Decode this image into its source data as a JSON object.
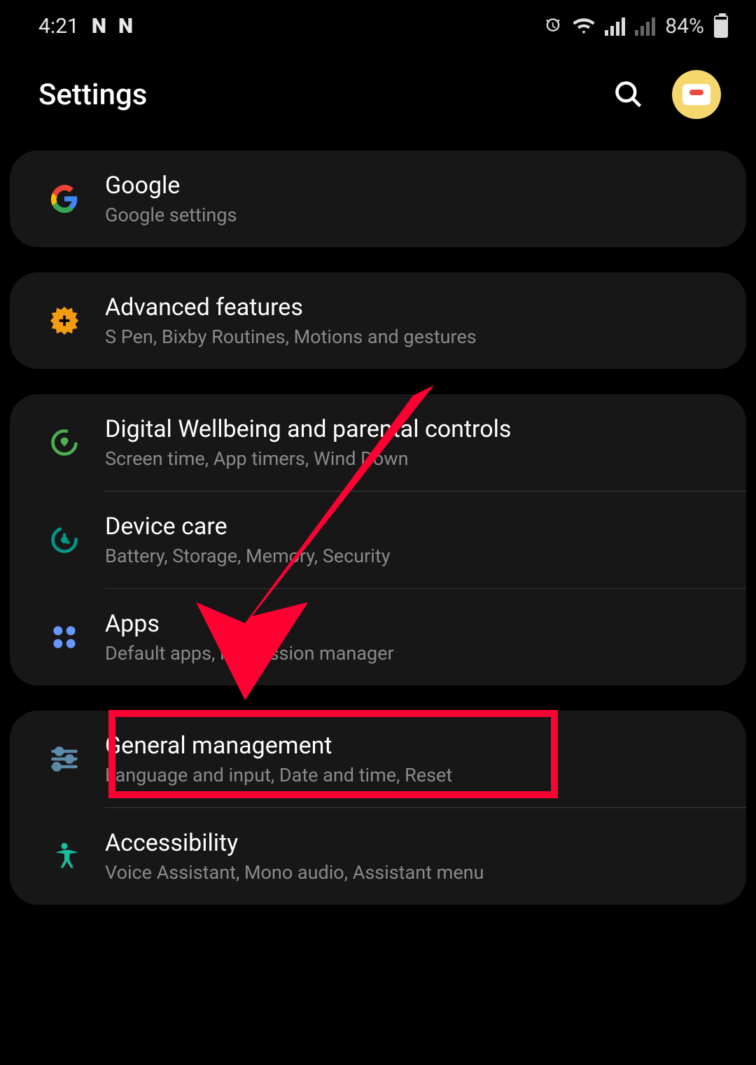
{
  "status_bar": {
    "time": "4:21",
    "battery_percent": "84%"
  },
  "header": {
    "title": "Settings"
  },
  "groups": [
    {
      "items": [
        {
          "title": "Google",
          "subtitle": "Google settings"
        }
      ]
    },
    {
      "items": [
        {
          "title": "Advanced features",
          "subtitle": "S Pen, Bixby Routines, Motions and gestures"
        }
      ]
    },
    {
      "items": [
        {
          "title": "Digital Wellbeing and parental controls",
          "subtitle": "Screen time, App timers, Wind Down"
        },
        {
          "title": "Device care",
          "subtitle": "Battery, Storage, Memory, Security"
        },
        {
          "title": "Apps",
          "subtitle": "Default apps, Permission manager"
        }
      ]
    },
    {
      "items": [
        {
          "title": "General management",
          "subtitle": "Language and input, Date and time, Reset"
        },
        {
          "title": "Accessibility",
          "subtitle": "Voice Assistant, Mono audio, Assistant menu"
        }
      ]
    }
  ]
}
